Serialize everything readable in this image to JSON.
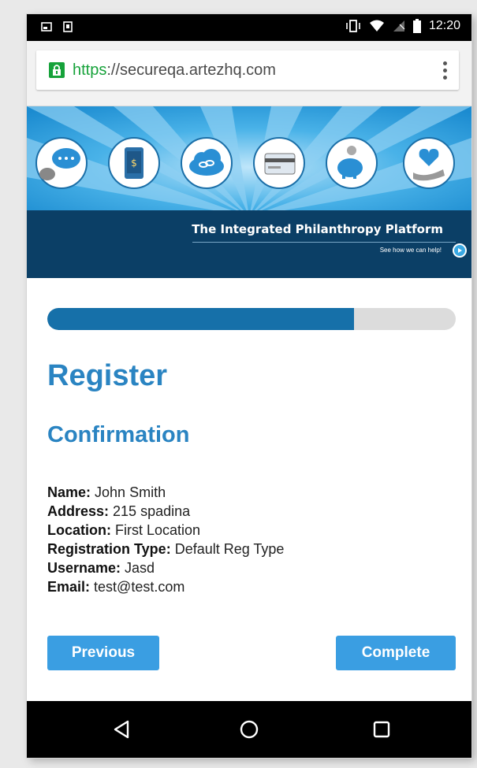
{
  "status_bar": {
    "time": "12:20"
  },
  "browser": {
    "url_scheme": "https",
    "url_rest": "://secureqa.artezhq.com"
  },
  "banner": {
    "tagline": "The Integrated Philanthropy Platform",
    "subtag": "See how we can help!",
    "icons": [
      "chat-bubbles-icon",
      "mobile-phone-icon",
      "cloud-link-icon",
      "credit-card-icon",
      "piggy-bank-icon",
      "heart-hand-icon"
    ]
  },
  "progress": {
    "fraction": 0.75
  },
  "page": {
    "title": "Register",
    "section": "Confirmation",
    "fields": [
      {
        "label": "Name:",
        "value": " John Smith"
      },
      {
        "label": "Address:",
        "value": " 215 spadina"
      },
      {
        "label": "Location:",
        "value": " First Location"
      },
      {
        "label": "Registration Type:",
        "value": " Default Reg Type"
      },
      {
        "label": "Username:",
        "value": " Jasd"
      },
      {
        "label": "Email:",
        "value": " test@test.com"
      }
    ],
    "buttons": {
      "previous": "Previous",
      "complete": "Complete"
    }
  },
  "colors": {
    "accent": "#2a84c2",
    "button": "#3a9ee2",
    "progress_fill": "#1670a9",
    "banner_dark": "#0b3f66"
  }
}
